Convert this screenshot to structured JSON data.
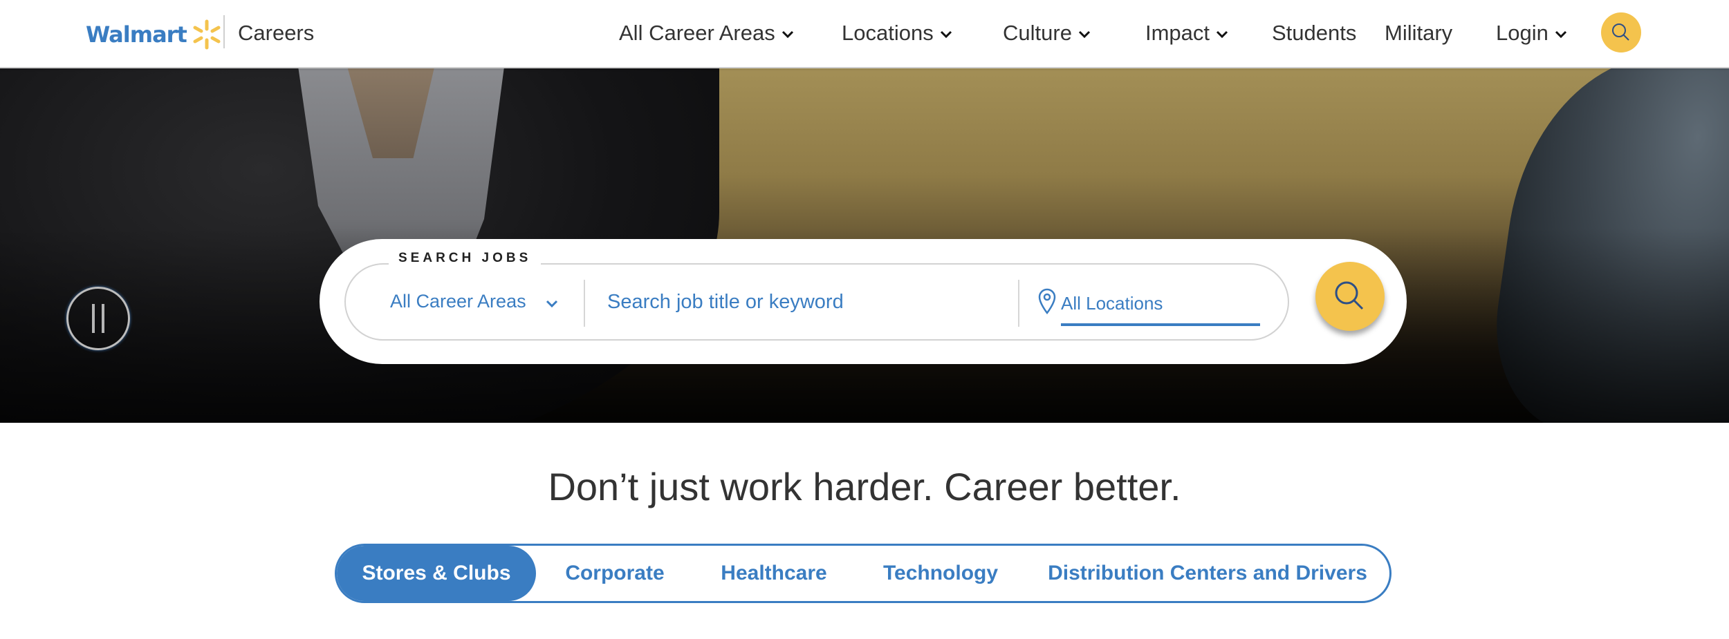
{
  "brand": {
    "logo_text": "Walmart",
    "section": "Careers",
    "colors": {
      "blue": "#3a7dc2",
      "yellow": "#f4c34d",
      "text": "#333333"
    }
  },
  "nav": {
    "items": [
      {
        "label": "All Career Areas",
        "dropdown": true
      },
      {
        "label": "Locations",
        "dropdown": true
      },
      {
        "label": "Culture",
        "dropdown": true
      },
      {
        "label": "Impact",
        "dropdown": true
      },
      {
        "label": "Students",
        "dropdown": false
      },
      {
        "label": "Military",
        "dropdown": false
      },
      {
        "label": "Login",
        "dropdown": true
      }
    ],
    "search_icon": "search-icon"
  },
  "hero": {
    "pause_icon": "pause-icon"
  },
  "search": {
    "legend": "SEARCH JOBS",
    "career_area_value": "All Career Areas",
    "keyword_placeholder": "Search job title or keyword",
    "keyword_value": "",
    "location_value": "All Locations",
    "location_icon": "map-pin-icon",
    "submit_icon": "search-icon"
  },
  "tagline": "Don’t just work harder. Career better.",
  "tabs": [
    {
      "label": "Stores & Clubs",
      "active": true
    },
    {
      "label": "Corporate",
      "active": false
    },
    {
      "label": "Healthcare",
      "active": false
    },
    {
      "label": "Technology",
      "active": false
    },
    {
      "label": "Distribution Centers and Drivers",
      "active": false
    }
  ]
}
